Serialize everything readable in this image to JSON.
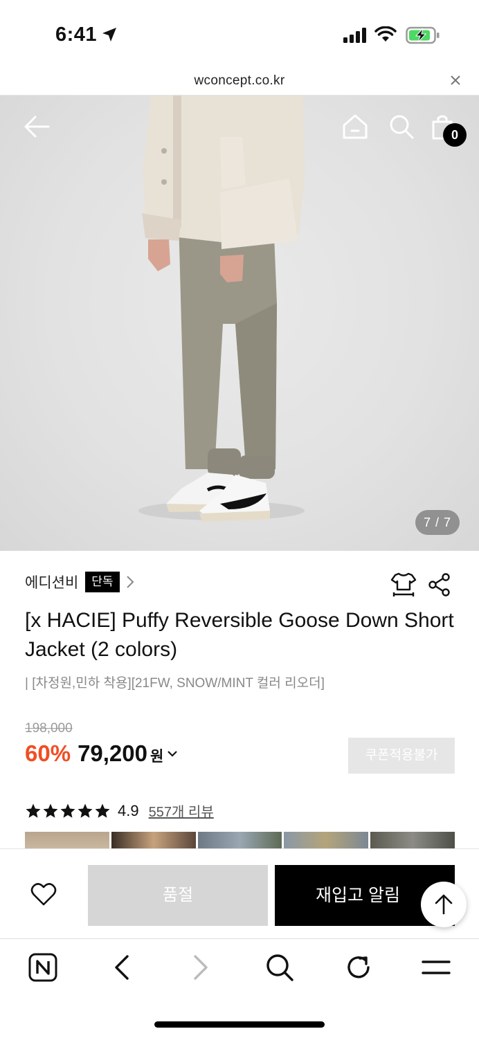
{
  "status_bar": {
    "time": "6:41"
  },
  "browser": {
    "url": "wconcept.co.kr"
  },
  "gallery": {
    "counter": "7 / 7"
  },
  "header": {
    "cart_count": "0"
  },
  "product": {
    "brand": "에디션비",
    "badge": "단독",
    "title": "[x HACIE] Puffy Reversible Goose Down Short Jacket (2 colors)",
    "subtitle": "| [차정원,민하 착용][21FW, SNOW/MINT 컬러 리오더]",
    "original_price": "198,000",
    "discount": "60%",
    "price": "79,200",
    "currency": "원",
    "coupon_label": "쿠폰적용불가",
    "rating": "4.9",
    "stars": 5,
    "review_count_label": "557개 리뷰"
  },
  "actions": {
    "soldout_label": "품절",
    "restock_label": "재입고 알림"
  },
  "colors": {
    "accent_discount": "#f04e23",
    "disabled_gray": "#d6d6d6",
    "primary_black": "#000000"
  },
  "icons": {
    "back": "arrow-left-icon",
    "home": "home-icon",
    "search": "search-icon",
    "cart": "shopping-bag-icon",
    "size": "size-guide-icon",
    "share": "share-icon",
    "wish": "heart-icon",
    "top": "arrow-up-icon"
  }
}
